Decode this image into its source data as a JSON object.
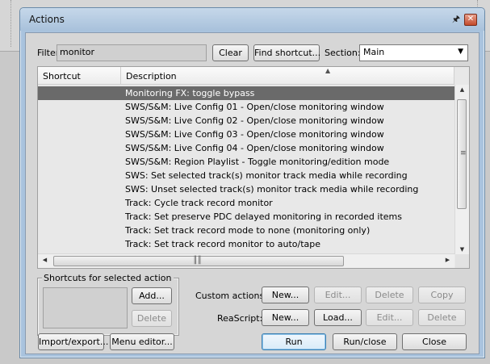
{
  "window": {
    "title": "Actions"
  },
  "filter": {
    "label": "Filter:",
    "value": "monitor",
    "clear_label": "Clear",
    "find_shortcut_label": "Find shortcut..."
  },
  "section": {
    "label": "Section:",
    "value": "Main"
  },
  "list": {
    "columns": [
      "Shortcut",
      "Description"
    ],
    "rows": [
      "Monitoring FX: toggle bypass",
      "SWS/S&M: Live Config 01 - Open/close monitoring window",
      "SWS/S&M: Live Config 02 - Open/close monitoring window",
      "SWS/S&M: Live Config 03 - Open/close monitoring window",
      "SWS/S&M: Live Config 04 - Open/close monitoring window",
      "SWS/S&M: Region Playlist - Toggle monitoring/edition mode",
      "SWS: Set selected track(s) monitor track media while recording",
      "SWS: Unset selected track(s) monitor track media while recording",
      "Track: Cycle track record monitor",
      "Track: Set preserve PDC delayed monitoring in recorded items",
      "Track: Set track record mode to none (monitoring only)",
      "Track: Set track record monitor to auto/tape"
    ],
    "selected_index": 0
  },
  "shortcuts": {
    "legend": "Shortcuts for selected action",
    "add_label": "Add...",
    "delete_label": "Delete"
  },
  "custom_actions": {
    "label": "Custom actions:",
    "new_label": "New...",
    "edit_label": "Edit...",
    "delete_label": "Delete",
    "copy_label": "Copy"
  },
  "reascript": {
    "label": "ReaScript:",
    "new_label": "New...",
    "load_label": "Load...",
    "edit_label": "Edit...",
    "delete_label": "Delete"
  },
  "footer": {
    "import_export_label": "Import/export...",
    "menu_editor_label": "Menu editor...",
    "run_label": "Run",
    "run_close_label": "Run/close",
    "close_label": "Close"
  },
  "icons": {
    "pin": "pin-icon",
    "close": "close-icon",
    "dropdown": "chevron-down-icon",
    "sort": "sort-ascending-icon"
  }
}
